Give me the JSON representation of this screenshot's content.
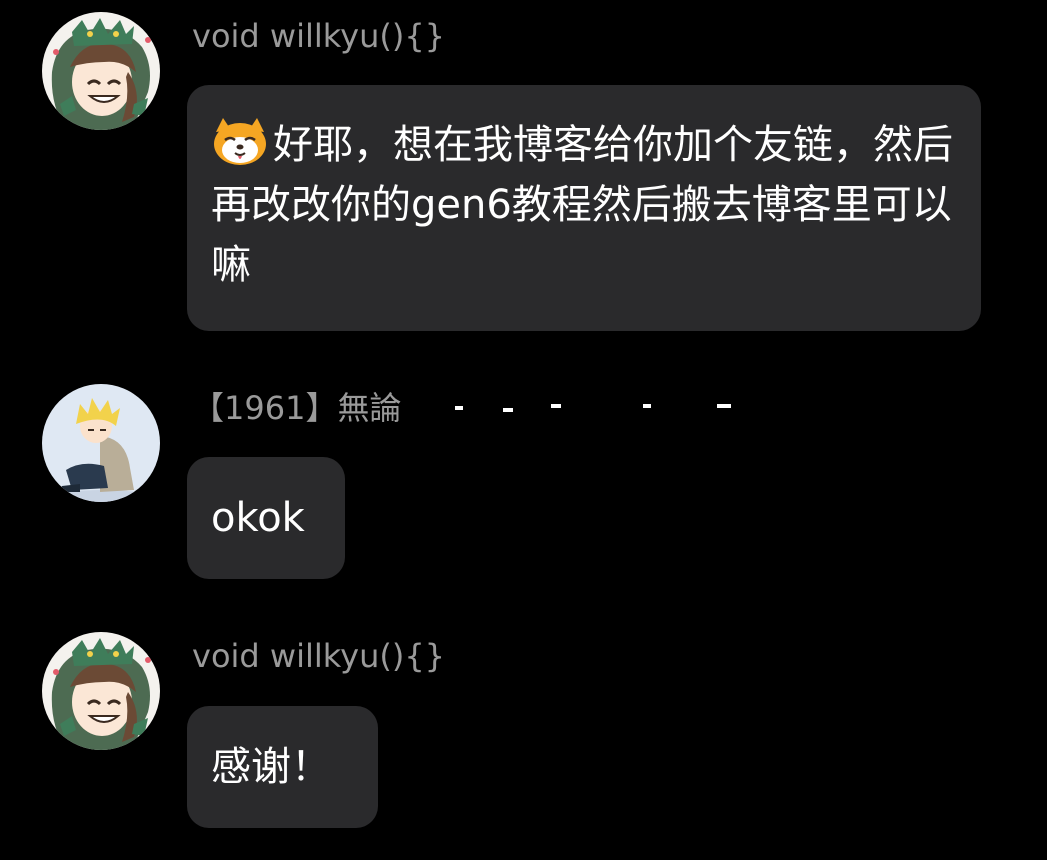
{
  "messages": [
    {
      "sender": "void willkyu(){}",
      "text": "好耶，想在我博客给你加个友链，然后再改改你的gen6教程然后搬去博客里可以嘛",
      "emoji": "dog-face-emoji"
    },
    {
      "sender": "【1961】無論",
      "text": "okok"
    },
    {
      "sender": "void willkyu(){}",
      "text": "感谢！"
    }
  ],
  "colors": {
    "background": "#000000",
    "bubble": "#2a2a2c",
    "sender_text": "#9a9a9a",
    "message_text": "#ffffff"
  }
}
